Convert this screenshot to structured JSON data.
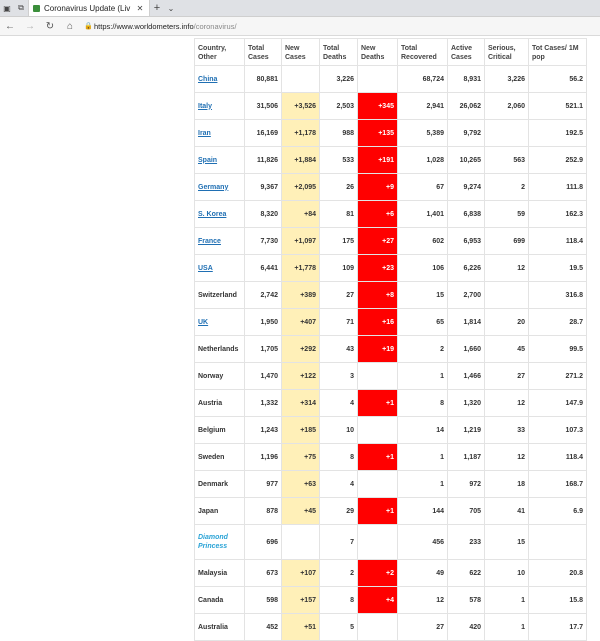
{
  "browser": {
    "tab_title": "Coronavirus Update (Liv",
    "url_host": "https://www.worldometers.info",
    "url_path": "/coronavirus/"
  },
  "table": {
    "headers": {
      "country": "Country, Other",
      "total_cases": "Total Cases",
      "new_cases": "New Cases",
      "total_deaths": "Total Deaths",
      "new_deaths": "New Deaths",
      "total_recovered": "Total Recovered",
      "active_cases": "Active Cases",
      "serious": "Serious, Critical",
      "per_million": "Tot Cases/ 1M pop"
    },
    "rows": [
      {
        "country": "China",
        "link": true,
        "total_cases": "80,881",
        "new_cases": "",
        "total_deaths": "3,226",
        "new_deaths": "",
        "total_recovered": "68,724",
        "active_cases": "8,931",
        "serious": "3,226",
        "per_million": "56.2"
      },
      {
        "country": "Italy",
        "link": true,
        "total_cases": "31,506",
        "new_cases": "+3,526",
        "total_deaths": "2,503",
        "new_deaths": "+345",
        "total_recovered": "2,941",
        "active_cases": "26,062",
        "serious": "2,060",
        "per_million": "521.1"
      },
      {
        "country": "Iran",
        "link": true,
        "total_cases": "16,169",
        "new_cases": "+1,178",
        "total_deaths": "988",
        "new_deaths": "+135",
        "total_recovered": "5,389",
        "active_cases": "9,792",
        "serious": "",
        "per_million": "192.5"
      },
      {
        "country": "Spain",
        "link": true,
        "total_cases": "11,826",
        "new_cases": "+1,884",
        "total_deaths": "533",
        "new_deaths": "+191",
        "total_recovered": "1,028",
        "active_cases": "10,265",
        "serious": "563",
        "per_million": "252.9"
      },
      {
        "country": "Germany",
        "link": true,
        "total_cases": "9,367",
        "new_cases": "+2,095",
        "total_deaths": "26",
        "new_deaths": "+9",
        "total_recovered": "67",
        "active_cases": "9,274",
        "serious": "2",
        "per_million": "111.8"
      },
      {
        "country": "S. Korea",
        "link": true,
        "total_cases": "8,320",
        "new_cases": "+84",
        "total_deaths": "81",
        "new_deaths": "+6",
        "total_recovered": "1,401",
        "active_cases": "6,838",
        "serious": "59",
        "per_million": "162.3"
      },
      {
        "country": "France",
        "link": true,
        "total_cases": "7,730",
        "new_cases": "+1,097",
        "total_deaths": "175",
        "new_deaths": "+27",
        "total_recovered": "602",
        "active_cases": "6,953",
        "serious": "699",
        "per_million": "118.4"
      },
      {
        "country": "USA",
        "link": true,
        "total_cases": "6,441",
        "new_cases": "+1,778",
        "total_deaths": "109",
        "new_deaths": "+23",
        "total_recovered": "106",
        "active_cases": "6,226",
        "serious": "12",
        "per_million": "19.5"
      },
      {
        "country": "Switzerland",
        "link": false,
        "total_cases": "2,742",
        "new_cases": "+389",
        "total_deaths": "27",
        "new_deaths": "+8",
        "total_recovered": "15",
        "active_cases": "2,700",
        "serious": "",
        "per_million": "316.8"
      },
      {
        "country": "UK",
        "link": true,
        "total_cases": "1,950",
        "new_cases": "+407",
        "total_deaths": "71",
        "new_deaths": "+16",
        "total_recovered": "65",
        "active_cases": "1,814",
        "serious": "20",
        "per_million": "28.7"
      },
      {
        "country": "Netherlands",
        "link": false,
        "total_cases": "1,705",
        "new_cases": "+292",
        "total_deaths": "43",
        "new_deaths": "+19",
        "total_recovered": "2",
        "active_cases": "1,660",
        "serious": "45",
        "per_million": "99.5"
      },
      {
        "country": "Norway",
        "link": false,
        "total_cases": "1,470",
        "new_cases": "+122",
        "total_deaths": "3",
        "new_deaths": "",
        "total_recovered": "1",
        "active_cases": "1,466",
        "serious": "27",
        "per_million": "271.2"
      },
      {
        "country": "Austria",
        "link": false,
        "total_cases": "1,332",
        "new_cases": "+314",
        "total_deaths": "4",
        "new_deaths": "+1",
        "total_recovered": "8",
        "active_cases": "1,320",
        "serious": "12",
        "per_million": "147.9"
      },
      {
        "country": "Belgium",
        "link": false,
        "total_cases": "1,243",
        "new_cases": "+185",
        "total_deaths": "10",
        "new_deaths": "",
        "total_recovered": "14",
        "active_cases": "1,219",
        "serious": "33",
        "per_million": "107.3"
      },
      {
        "country": "Sweden",
        "link": false,
        "total_cases": "1,196",
        "new_cases": "+75",
        "total_deaths": "8",
        "new_deaths": "+1",
        "total_recovered": "1",
        "active_cases": "1,187",
        "serious": "12",
        "per_million": "118.4"
      },
      {
        "country": "Denmark",
        "link": false,
        "total_cases": "977",
        "new_cases": "+63",
        "total_deaths": "4",
        "new_deaths": "",
        "total_recovered": "1",
        "active_cases": "972",
        "serious": "18",
        "per_million": "168.7"
      },
      {
        "country": "Japan",
        "link": false,
        "total_cases": "878",
        "new_cases": "+45",
        "total_deaths": "29",
        "new_deaths": "+1",
        "total_recovered": "144",
        "active_cases": "705",
        "serious": "41",
        "per_million": "6.9"
      },
      {
        "country": "Diamond Princess",
        "special": true,
        "total_cases": "696",
        "new_cases": "",
        "total_deaths": "7",
        "new_deaths": "",
        "total_recovered": "456",
        "active_cases": "233",
        "serious": "15",
        "per_million": ""
      },
      {
        "country": "Malaysia",
        "link": false,
        "total_cases": "673",
        "new_cases": "+107",
        "total_deaths": "2",
        "new_deaths": "+2",
        "total_recovered": "49",
        "active_cases": "622",
        "serious": "10",
        "per_million": "20.8"
      },
      {
        "country": "Canada",
        "link": false,
        "total_cases": "598",
        "new_cases": "+157",
        "total_deaths": "8",
        "new_deaths": "+4",
        "total_recovered": "12",
        "active_cases": "578",
        "serious": "1",
        "per_million": "15.8"
      },
      {
        "country": "Australia",
        "link": false,
        "total_cases": "452",
        "new_cases": "+51",
        "total_deaths": "5",
        "new_deaths": "",
        "total_recovered": "27",
        "active_cases": "420",
        "serious": "1",
        "per_million": "17.7"
      }
    ]
  },
  "colors": {
    "new_cases_bg": "#fff0b8",
    "new_deaths_bg": "#ff0000",
    "link": "#1f6fb3",
    "special": "#2aa3d6"
  }
}
